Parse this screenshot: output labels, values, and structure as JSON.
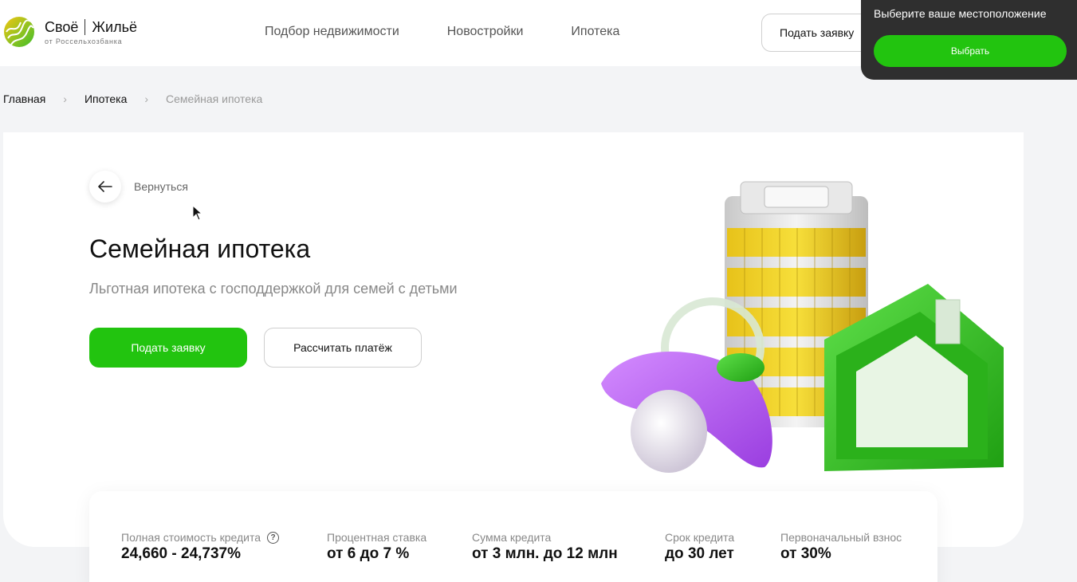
{
  "header": {
    "brand_name": "Своё",
    "brand_name2": "Жильё",
    "brand_sub": "от Россельхозбанка",
    "nav": [
      "Подбор недвижимости",
      "Новостройки",
      "Ипотека"
    ],
    "apply_label": "Подать заявку"
  },
  "location_popup": {
    "text": "Выберите ваше местоположение",
    "button_label": "Выбрать"
  },
  "breadcrumb": [
    "Главная",
    "Ипотека",
    "Семейная ипотека"
  ],
  "hero": {
    "back_label": "Вернуться",
    "title": "Семейная ипотека",
    "subtitle": "Льготная ипотека с господдержкой для семей с детьми",
    "primary_button": "Подать заявку",
    "secondary_button": "Рассчитать платёж"
  },
  "stats": [
    {
      "label": "Полная стоимость кредита",
      "value": "24,660 - 24,737%"
    },
    {
      "label": "Процентная ставка",
      "value": "от 6 до 7 %"
    },
    {
      "label": "Сумма кредита",
      "value": "от 3 млн. до 12 млн"
    },
    {
      "label": "Срок кредита",
      "value": "до 30 лет"
    },
    {
      "label": "Первоначальный взнос",
      "value": "от 30%"
    }
  ],
  "colors": {
    "accent": "#22c40f",
    "popup_bg": "#2f2f2f",
    "page_bg": "#f3f4f6"
  },
  "icons": [
    "logo-mark-icon",
    "chevron-right-icon",
    "arrow-left-icon",
    "help-icon",
    "cursor-icon"
  ]
}
